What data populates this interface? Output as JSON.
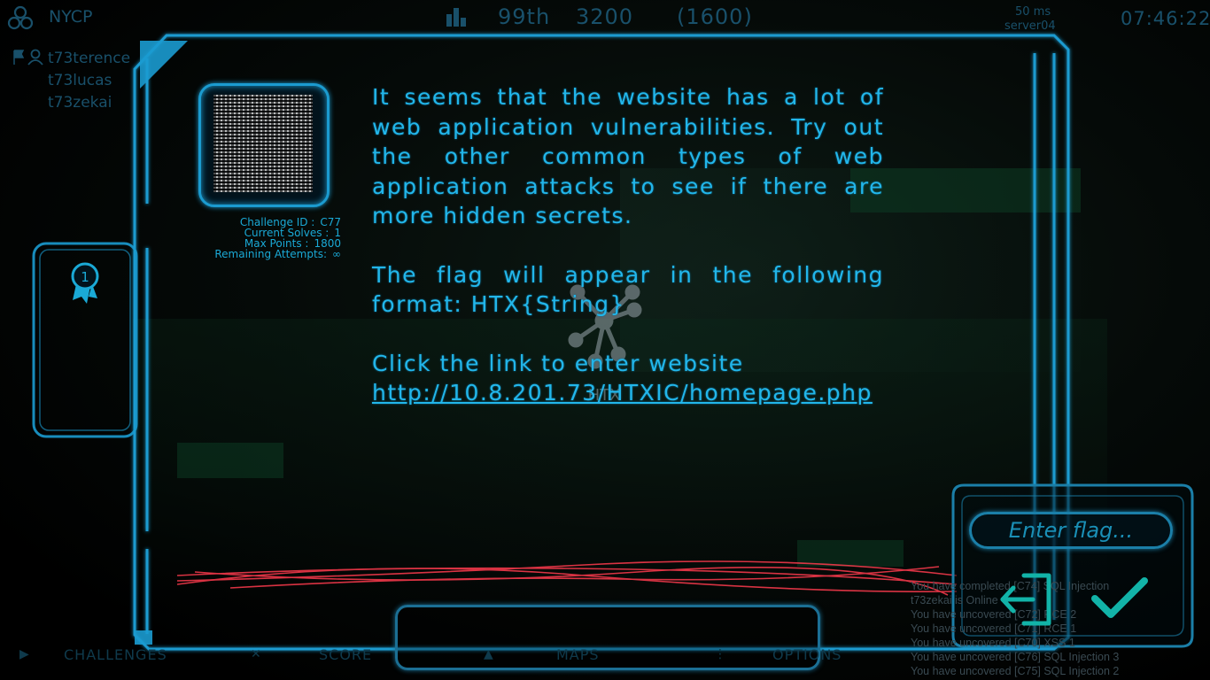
{
  "topbar": {
    "team": "NYCP",
    "rank": "99th",
    "score": "3200",
    "subscore": "(1600)",
    "ping": "50 ms",
    "server": "server04",
    "clock": "07:46:22"
  },
  "members": [
    "t73terence",
    "t73lucas",
    "t73zekai"
  ],
  "challenge": {
    "id_label": "Challenge ID  :",
    "id_value": "C77",
    "solves_label": "Current Solves :",
    "solves_value": "1",
    "points_label": "Max Points   :",
    "points_value": "1800",
    "attempts_label": "Remaining Attempts:",
    "attempts_value": "∞",
    "paragraph1": "It seems that the website has a lot of web application vulnerabilities. Try out the other common types of web application attacks to see if there are more hidden secrets.",
    "paragraph2": "The flag will appear in the following format: HTX{String}",
    "paragraph3": "Click the link to enter website",
    "link": "http://10.8.201.73/HTXIC/homepage.php"
  },
  "badge": {
    "number": "1"
  },
  "flag": {
    "placeholder": "Enter flag..."
  },
  "log": [
    "You have completed [C74] SQL Injection",
    "t73zekai is Online",
    "You have uncovered [C72] RCE 2",
    "You have uncovered [C71] RCE 1",
    "You have uncovered [C70] XSS 1",
    "You have uncovered [C76] SQL Injection 3",
    "You have uncovered [C75] SQL Injection 2"
  ],
  "nav": {
    "challenges": "CHALLENGES",
    "score": "SCORE",
    "maps": "MAPS",
    "options": "OPTIONS"
  },
  "colors": {
    "accent": "#1b9bd0",
    "text": "#22b6ea",
    "dim": "#19506a",
    "laser": "#ff3b4e"
  }
}
